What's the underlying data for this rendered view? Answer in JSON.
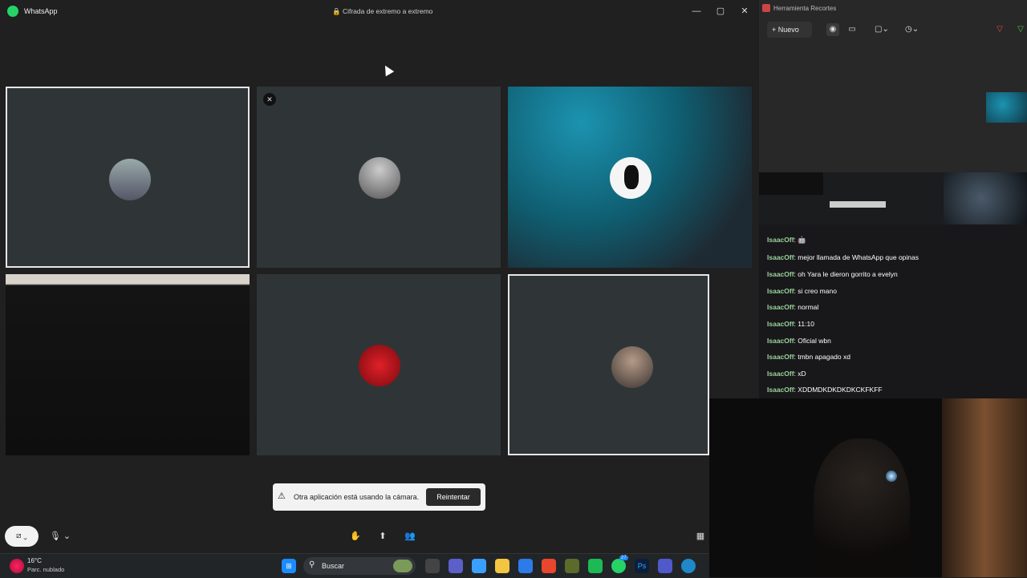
{
  "wa": {
    "app_name": "WhatsApp",
    "encryption": "Cifrada de extremo a extremo",
    "window_controls": [
      "—",
      "▢",
      "✕"
    ],
    "toast_message": "Otra aplicación está usando la cámara.",
    "toast_button": "Reintentar",
    "controls": {
      "camera": "📷",
      "mic": "🎤",
      "hand": "✋",
      "share": "⬆",
      "people": "👥",
      "layout": "▦"
    }
  },
  "participants": [
    {
      "id": "p1",
      "selected": true,
      "muted": false,
      "avatar_color": "#7a8b88",
      "bg": "#2f3537"
    },
    {
      "id": "p2",
      "selected": false,
      "muted": true,
      "avatar_color": "#8c8f8e",
      "bg": "#2f3537"
    },
    {
      "id": "p3",
      "selected": false,
      "muted": false,
      "avatar_color": "#f5f5f5",
      "bg": "gradient-teal"
    },
    {
      "id": "p4",
      "selected": false,
      "muted": false,
      "avatar_color": "#000000",
      "bg": "#111111"
    },
    {
      "id": "p5",
      "selected": false,
      "muted": false,
      "avatar_color": "#c0141a",
      "bg": "#2f3537"
    },
    {
      "id": "p6",
      "selected": true,
      "muted": false,
      "avatar_color": "#5a4d44",
      "bg": "#2f3537"
    }
  ],
  "taskbar": {
    "weather_temp": "16°C",
    "weather_desc": "Parc. nublado",
    "search_label": "Buscar",
    "whatsapp_badge": "27"
  },
  "snip": {
    "title": "Herramienta Recortes",
    "new_label": "Nuevo"
  },
  "chat": {
    "messages": [
      {
        "user": "IsaacOff",
        "text": "🤖"
      },
      {
        "user": "IsaacOff",
        "text": "mejor llamada de WhatsApp que opinas"
      },
      {
        "user": "IsaacOff",
        "text": "oh Yara le dieron gorrito a evelyn"
      },
      {
        "user": "IsaacOff",
        "text": "si creo mano"
      },
      {
        "user": "IsaacOff",
        "text": "normal"
      },
      {
        "user": "IsaacOff",
        "text": "11:10"
      },
      {
        "user": "IsaacOff",
        "text": "Oficial wbn"
      },
      {
        "user": "IsaacOff",
        "text": "tmbn apagado xd"
      },
      {
        "user": "IsaacOff",
        "text": "xD"
      },
      {
        "user": "IsaacOff",
        "text": "XDDMDKDKDKDKCKFKFF"
      }
    ]
  },
  "colors": {
    "accent": "#25d366",
    "tile": "#2f3537",
    "chat_user": "#9bd39b"
  }
}
